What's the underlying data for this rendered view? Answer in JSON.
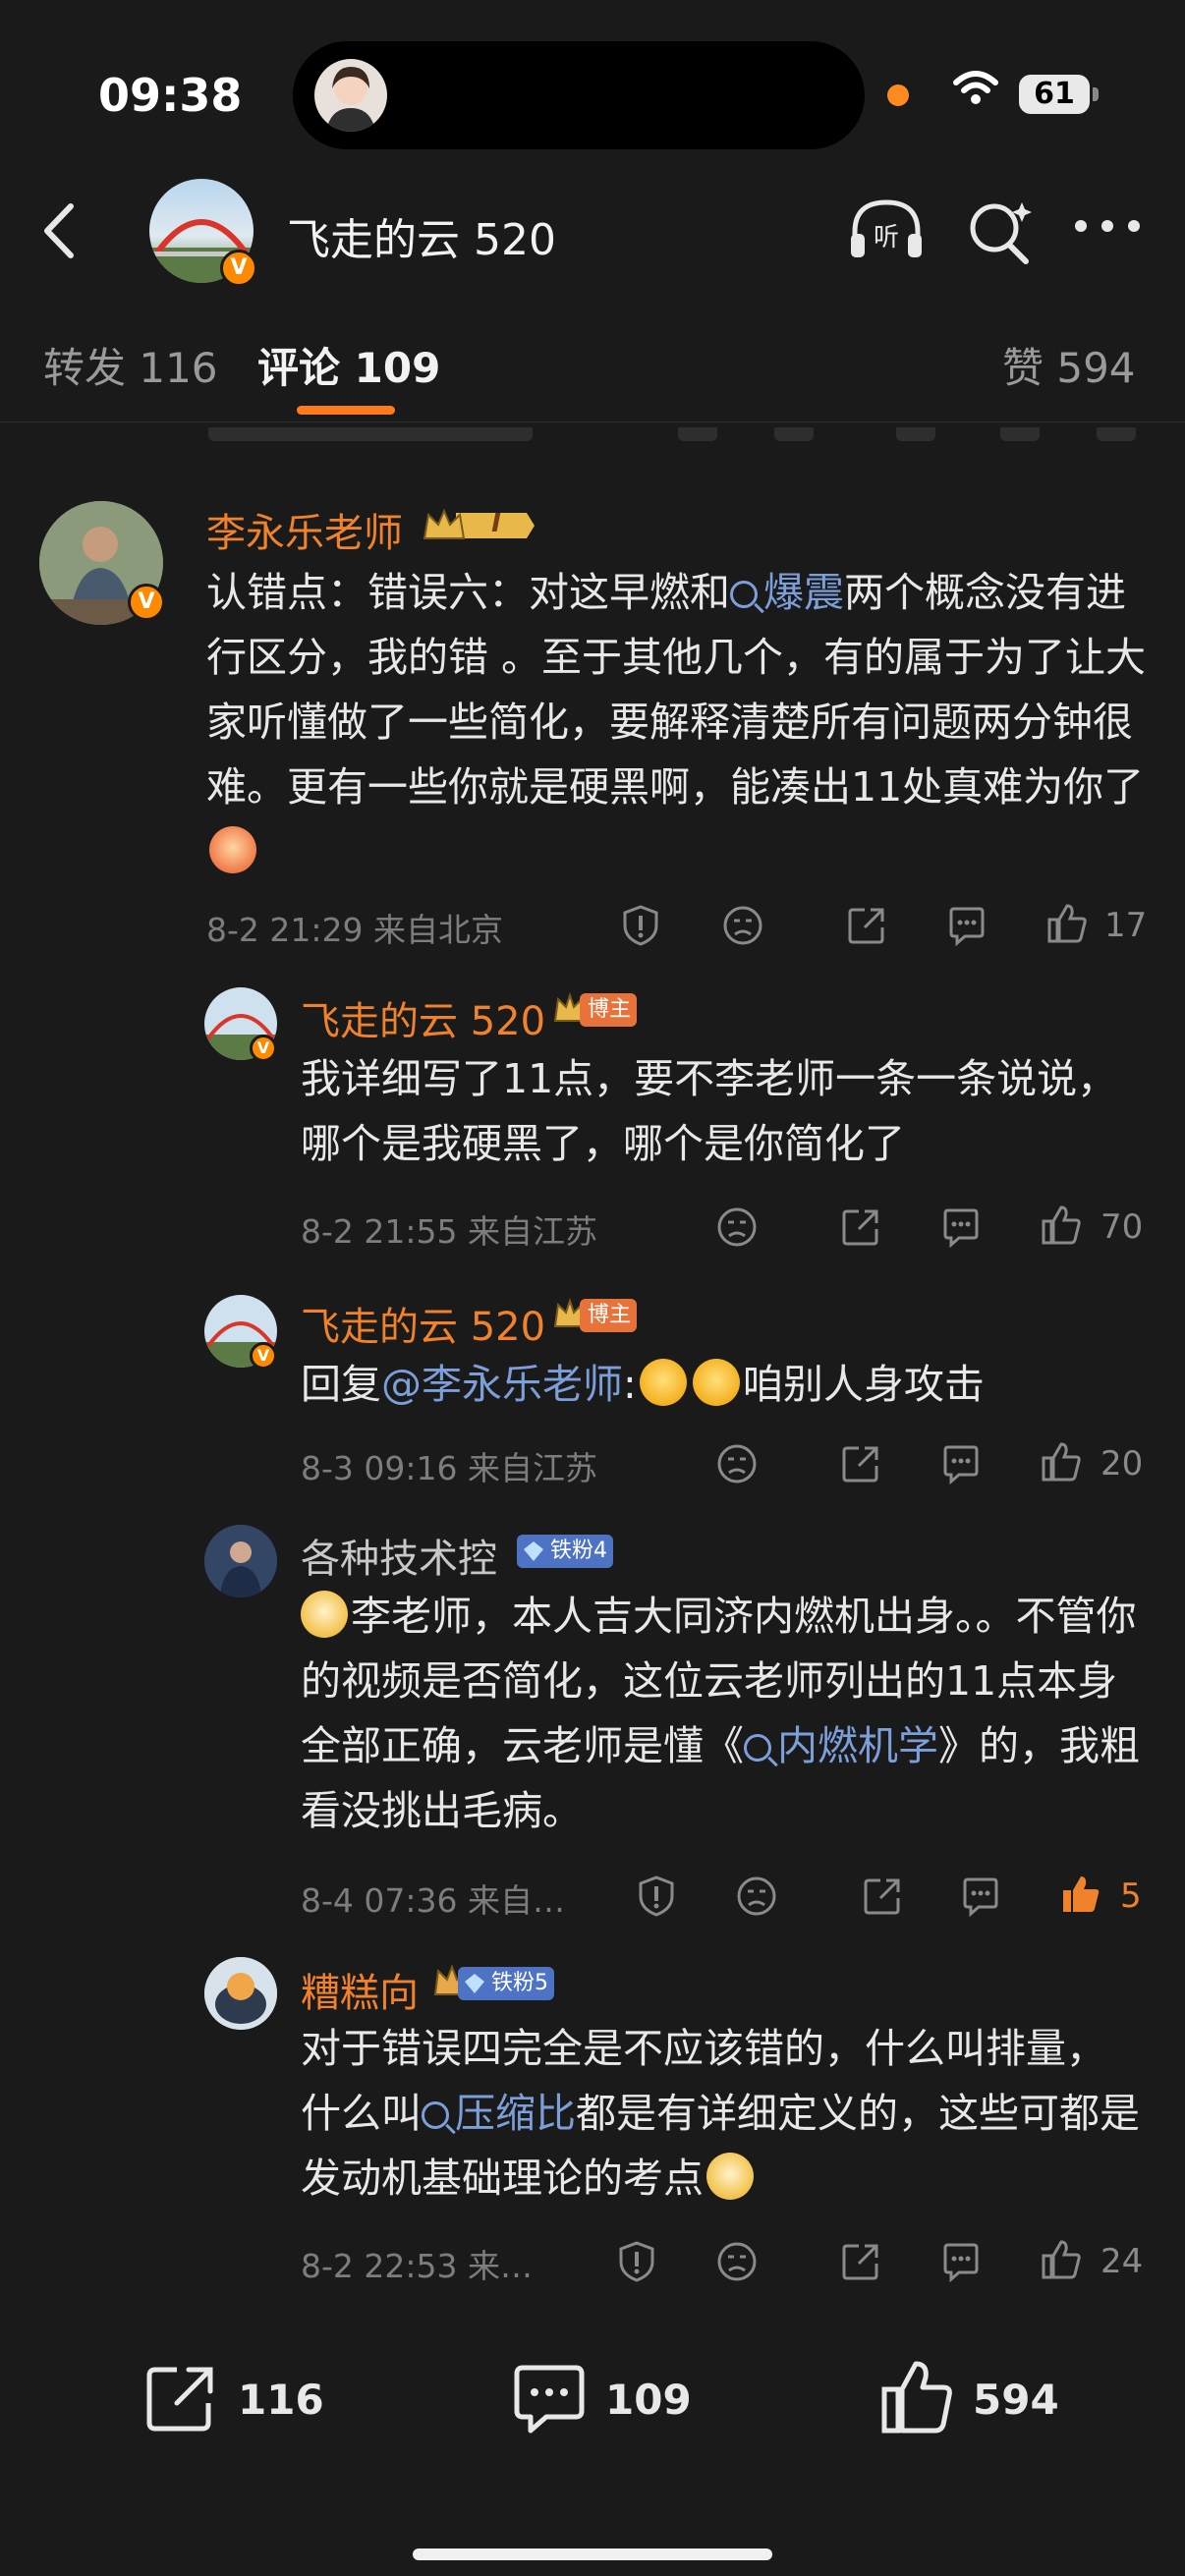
{
  "status_bar": {
    "time": "09:38",
    "battery": "61"
  },
  "nav": {
    "title": "飞走的云 520"
  },
  "tabs": [
    {
      "label": "转发 116"
    },
    {
      "label": "评论 109"
    },
    {
      "label": "赞 594"
    }
  ],
  "comments": [
    {
      "author": "李永乐老师",
      "badge": "I",
      "text_parts": [
        "认错点：错误六：对这早燃和",
        "爆震",
        "两个概念没有进行区分，我的错 。至于其他几个，有的属于为了让大家听懂做了一些简化，要解释清楚所有问题两分钟很难。更有一些你就是硬黑啊，能凑出11处真难为你了"
      ],
      "time": "8-2 21:29",
      "location": "来自北京",
      "likes": "17"
    },
    {
      "author": "飞走的云 520",
      "badge": "博主",
      "text": "我详细写了11点，要不李老师一条一条说说，哪个是我硬黑了，哪个是你简化了",
      "time": "8-2 21:55",
      "location": "来自江苏",
      "likes": "70"
    },
    {
      "author": "飞走的云 520",
      "badge": "博主",
      "reply_prefix": "回复",
      "mention": "@李永乐老师",
      "text_after": ":",
      "text_end": "咱别人身攻击",
      "time": "8-3 09:16",
      "location": "来自江苏",
      "likes": "20"
    },
    {
      "author": "各种技术控",
      "badge": "铁粉4",
      "text_parts": [
        "李老师，本人吉大同济内燃机出身。。不管你的视频是否简化，这位云老师列出的11点本身全部正确，云老师是懂《",
        "内燃机学",
        "》的，我粗看没挑出毛病。"
      ],
      "time": "8-4 07:36",
      "location": "来自…",
      "likes": "5"
    },
    {
      "author": "糟糕向",
      "badge": "铁粉5",
      "text_parts": [
        "对于错误四完全是不应该错的，什么叫排量，什么叫",
        "压缩比",
        "都是有详细定义的，这些可都是发动机基础理论的考点"
      ],
      "time": "8-2 22:53",
      "location": "来…",
      "likes": "24"
    }
  ],
  "bottom_bar": {
    "reposts": "116",
    "comments": "109",
    "likes": "594"
  },
  "colors": {
    "accent": "#f0822b",
    "link": "#7c9ed9",
    "background": "#1a1a1a"
  },
  "icons": [
    "back-arrow-icon",
    "listen-icon",
    "search-icon",
    "more-icon",
    "report-icon",
    "dislike-icon",
    "share-icon",
    "comment-icon",
    "like-icon"
  ]
}
